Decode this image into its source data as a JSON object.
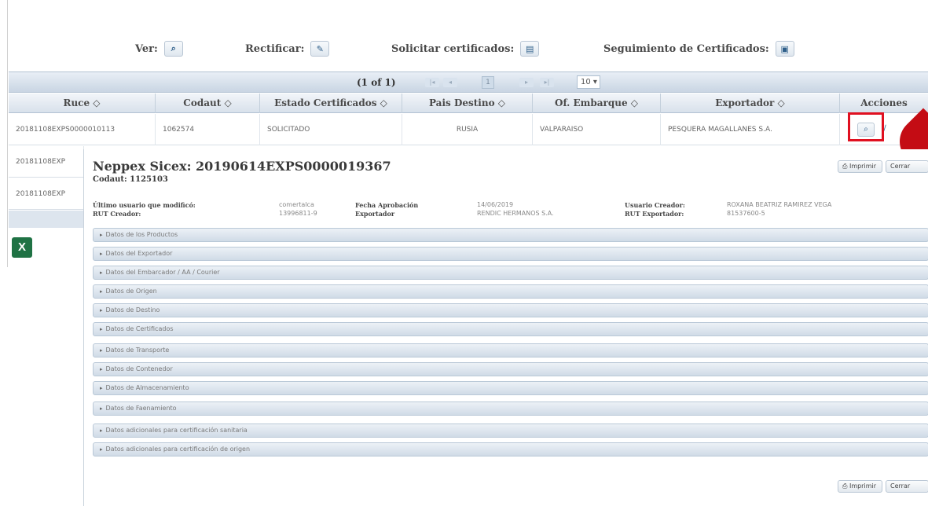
{
  "legend": {
    "ver_label": "Ver:",
    "rectificar_label": "Rectificar:",
    "solicitar_label": "Solicitar certificados:",
    "seguimiento_label": "Seguimiento de Certificados:"
  },
  "pager": {
    "page_info": "(1 of 1)",
    "rows_per_page": "10 ▾"
  },
  "table": {
    "headers": [
      "Ruce ◇",
      "Codaut ◇",
      "Estado Certificados ◇",
      "Pais Destino ◇",
      "Of. Embarque ◇",
      "Exportador ◇",
      "Acciones"
    ],
    "row1": {
      "ruce": "20181108EXPS0000010113",
      "codaut": "1062574",
      "estado": "SOLICITADO",
      "pais": "RUSIA",
      "oficina": "VALPARAISO",
      "exportador": "PESQUERA MAGALLANES S.A."
    },
    "row2": {
      "ruce": "20181108EXP"
    },
    "row3": {
      "ruce": "20181108EXP"
    }
  },
  "dialog": {
    "title": "Neppex Sicex: 20190614EXPS0000019367",
    "codaut": "Codaut: 1125103",
    "print_label": "Imprimir",
    "close_label": "Cerrar",
    "meta": {
      "ultimo_usuario_label": "Último usuario que modificó:",
      "ultimo_usuario_value": "comertalca",
      "rut_creador_label": "RUT Creador:",
      "rut_creador_value": "13996811-9",
      "fecha_aprobacion_label": "Fecha Aprobación",
      "fecha_aprobacion_value": "14/06/2019",
      "exportador_label": "Exportador",
      "exportador_value": "RENDIC HERMANOS S.A.",
      "usuario_creador_label": "Usuario Creador:",
      "usuario_creador_value": "ROXANA BEATRIZ RAMIREZ VEGA",
      "rut_exportador_label": "RUT Exportador:",
      "rut_exportador_value": "81537600-5"
    },
    "sections": [
      "Datos de los Productos",
      "Datos del Exportador",
      "Datos del Embarcador / AA / Courier",
      "Datos de Origen",
      "Datos de Destino",
      "Datos de Certificados",
      "Datos de Transporte",
      "Datos de Contenedor",
      "Datos de Almacenamiento",
      "Datos de Faenamiento",
      "Datos adicionales para certificación sanitaria",
      "Datos adicionales para certificación de origen"
    ]
  },
  "colors": {
    "highlight": "#e01020",
    "marker": "#c40c14",
    "excel": "#1f7244"
  }
}
